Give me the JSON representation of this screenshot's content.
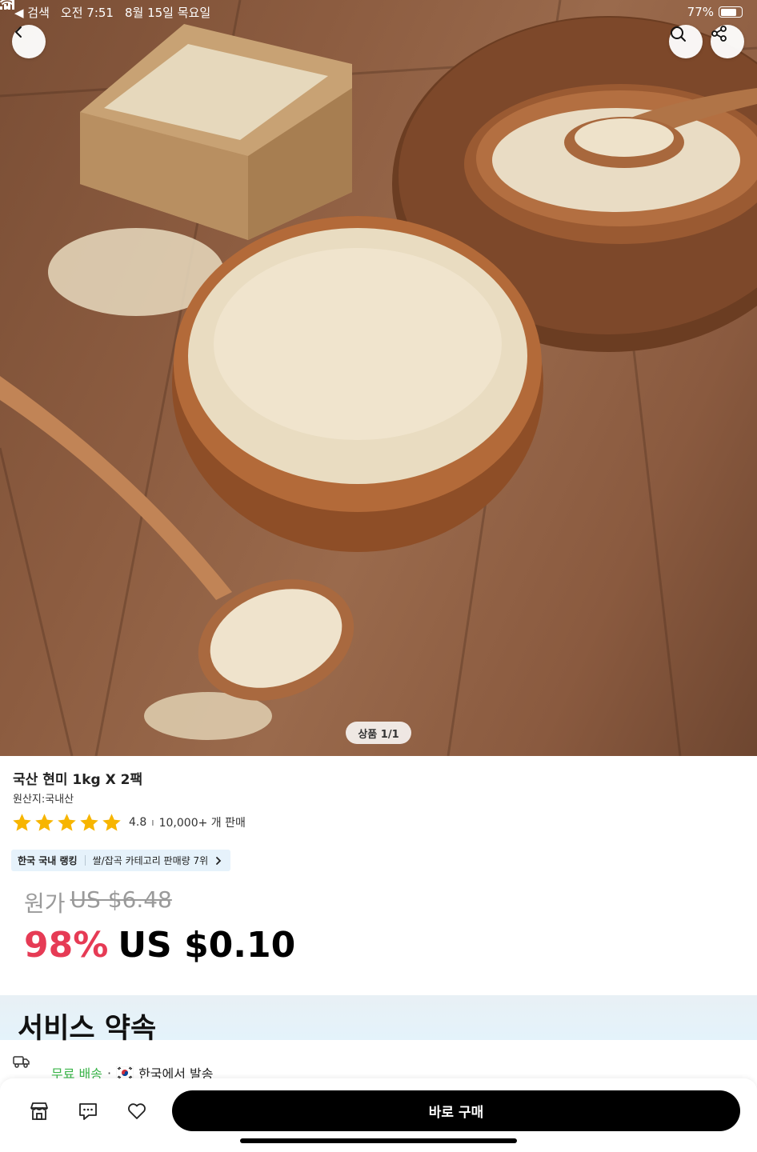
{
  "status_bar": {
    "back_app": "◀ 검색",
    "time": "오전 7:51",
    "date": "8월 15일 목요일",
    "battery": "77%",
    "battery_level": 0.77
  },
  "hero": {
    "pager": "상품 1/1"
  },
  "product": {
    "title": "국산 현미 1kg X 2팩",
    "origin": "원산지:국내산",
    "rating": "4.8",
    "rating_value": 4.8,
    "rating_max": 5,
    "rating_separator": "ı",
    "sold": "10,000+ 개 판매",
    "ranking": {
      "label": "한국 국내 랭킹",
      "detail": "쌀/잡곡 카테고리 판매량 7위"
    },
    "original_price_label": "원가",
    "original_price": "US $6.48",
    "discount": "98%",
    "price": "US $0.10"
  },
  "service": {
    "title": "서비스 약속",
    "free_shipping": "무료 배송",
    "dot": "·",
    "ships_from": "한국에서 발송"
  },
  "bottom_bar": {
    "buy_now": "바로 구매"
  },
  "colors": {
    "discount": "#e63b55",
    "free_shipping": "#3bb54a",
    "star": "#f7b500",
    "rank_chip_bg": "#e6f2fb",
    "buy_button": "#000000"
  },
  "icons": {
    "back": "chevron-left-icon",
    "search": "search-icon",
    "share": "share-icon",
    "truck": "truck-icon",
    "store": "store-icon",
    "chat": "chat-icon",
    "wishlist": "heart-icon"
  }
}
